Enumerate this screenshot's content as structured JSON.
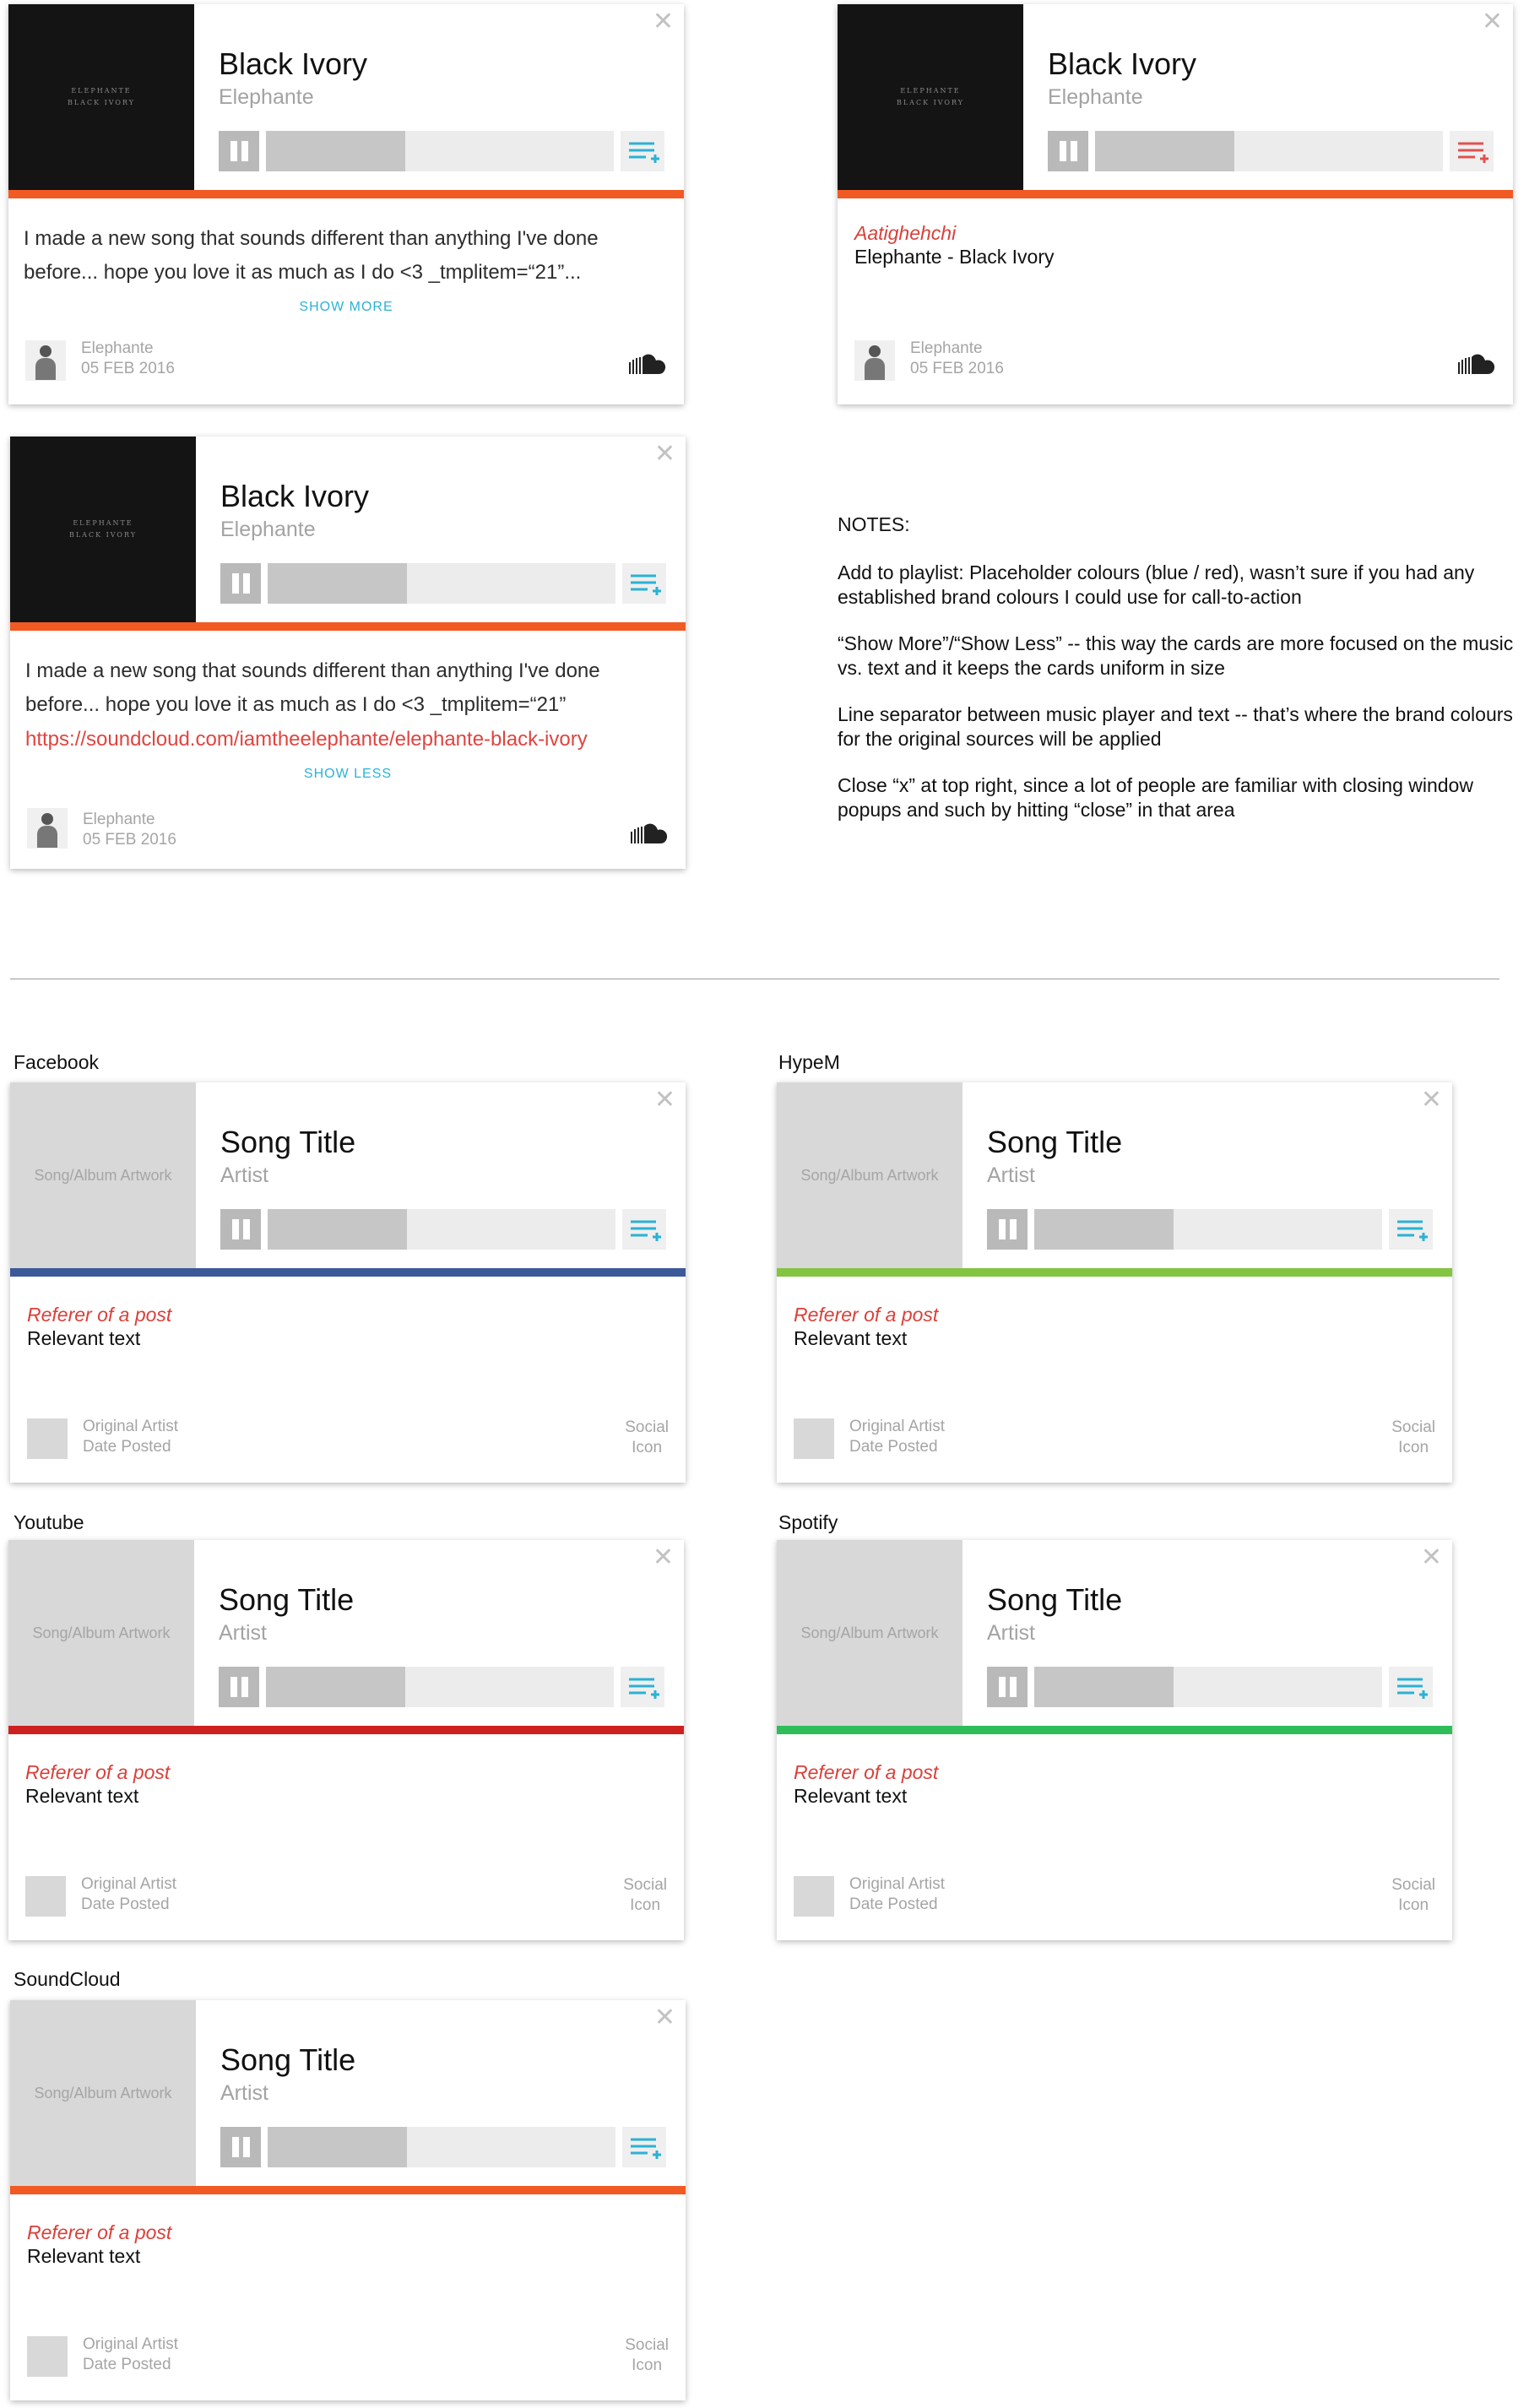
{
  "common": {
    "close_glyph": "✕"
  },
  "card_a": {
    "title": "Black Ivory",
    "artist": "Elephante",
    "art_text": "ELEPHANTE\nBLACK IVORY",
    "progress": 0.4,
    "description": "I made a new song that sounds different than anything I've done before... hope you love it as much as I do <3 _tmplitem=“21”...",
    "toggle": "SHOW MORE",
    "footer_artist": "Elephante",
    "footer_date": "05 FEB 2016",
    "social_icon": "soundcloud-icon",
    "bar_color": "#f15a22",
    "add_icon_color": "#29b2d5"
  },
  "card_b": {
    "title": "Black Ivory",
    "artist": "Elephante",
    "art_text": "ELEPHANTE\nBLACK IVORY",
    "progress": 0.4,
    "referer": "Aatighehchi",
    "relevant": "Elephante - Black Ivory",
    "footer_artist": "Elephante",
    "footer_date": "05 FEB 2016",
    "social_icon": "soundcloud-icon",
    "bar_color": "#f15a22",
    "add_icon_color": "#e05150"
  },
  "card_c": {
    "title": "Black Ivory",
    "artist": "Elephante",
    "art_text": "ELEPHANTE\nBLACK IVORY",
    "progress": 0.4,
    "description": "I made a new song that sounds different than anything I've done before... hope you love it as much as I do <3 _tmplitem=“21”",
    "link": "https://soundcloud.com/iamtheelephante/elephante-black-ivory",
    "toggle": "SHOW LESS",
    "footer_artist": "Elephante",
    "footer_date": "05 FEB 2016",
    "social_icon": "soundcloud-icon",
    "bar_color": "#f15a22",
    "add_icon_color": "#29b2d5"
  },
  "notes": {
    "heading": "NOTES:",
    "items": [
      "Add to playlist: Placeholder colours (blue / red), wasn’t sure if you had any established brand colours I could use for call-to-action",
      "“Show More”/“Show Less” -- this way the cards are more focused on the music vs. text and it keeps the cards uniform in size",
      "Line separator between music player and text -- that’s where the brand colours for the original sources will be applied",
      "Close “x” at top right, since a lot of people are familiar with closing window popups and such by hitting “close” in that area"
    ]
  },
  "templates": [
    {
      "label": "Facebook",
      "bar_color": "#3b5998"
    },
    {
      "label": "HypeM",
      "bar_color": "#83c441"
    },
    {
      "label": "Youtube",
      "bar_color": "#cd201f"
    },
    {
      "label": "Spotify",
      "bar_color": "#2ebd59"
    },
    {
      "label": "SoundCloud",
      "bar_color": "#f15a22"
    }
  ],
  "template_card": {
    "art_placeholder": "Song/Album Artwork",
    "title": "Song Title",
    "artist": "Artist",
    "progress": 0.4,
    "referer": "Referer of a post",
    "relevant": "Relevant text",
    "footer_artist": "Original Artist",
    "footer_date": "Date Posted",
    "social_line1": "Social",
    "social_line2": "Icon",
    "add_icon_color": "#29b2d5"
  }
}
